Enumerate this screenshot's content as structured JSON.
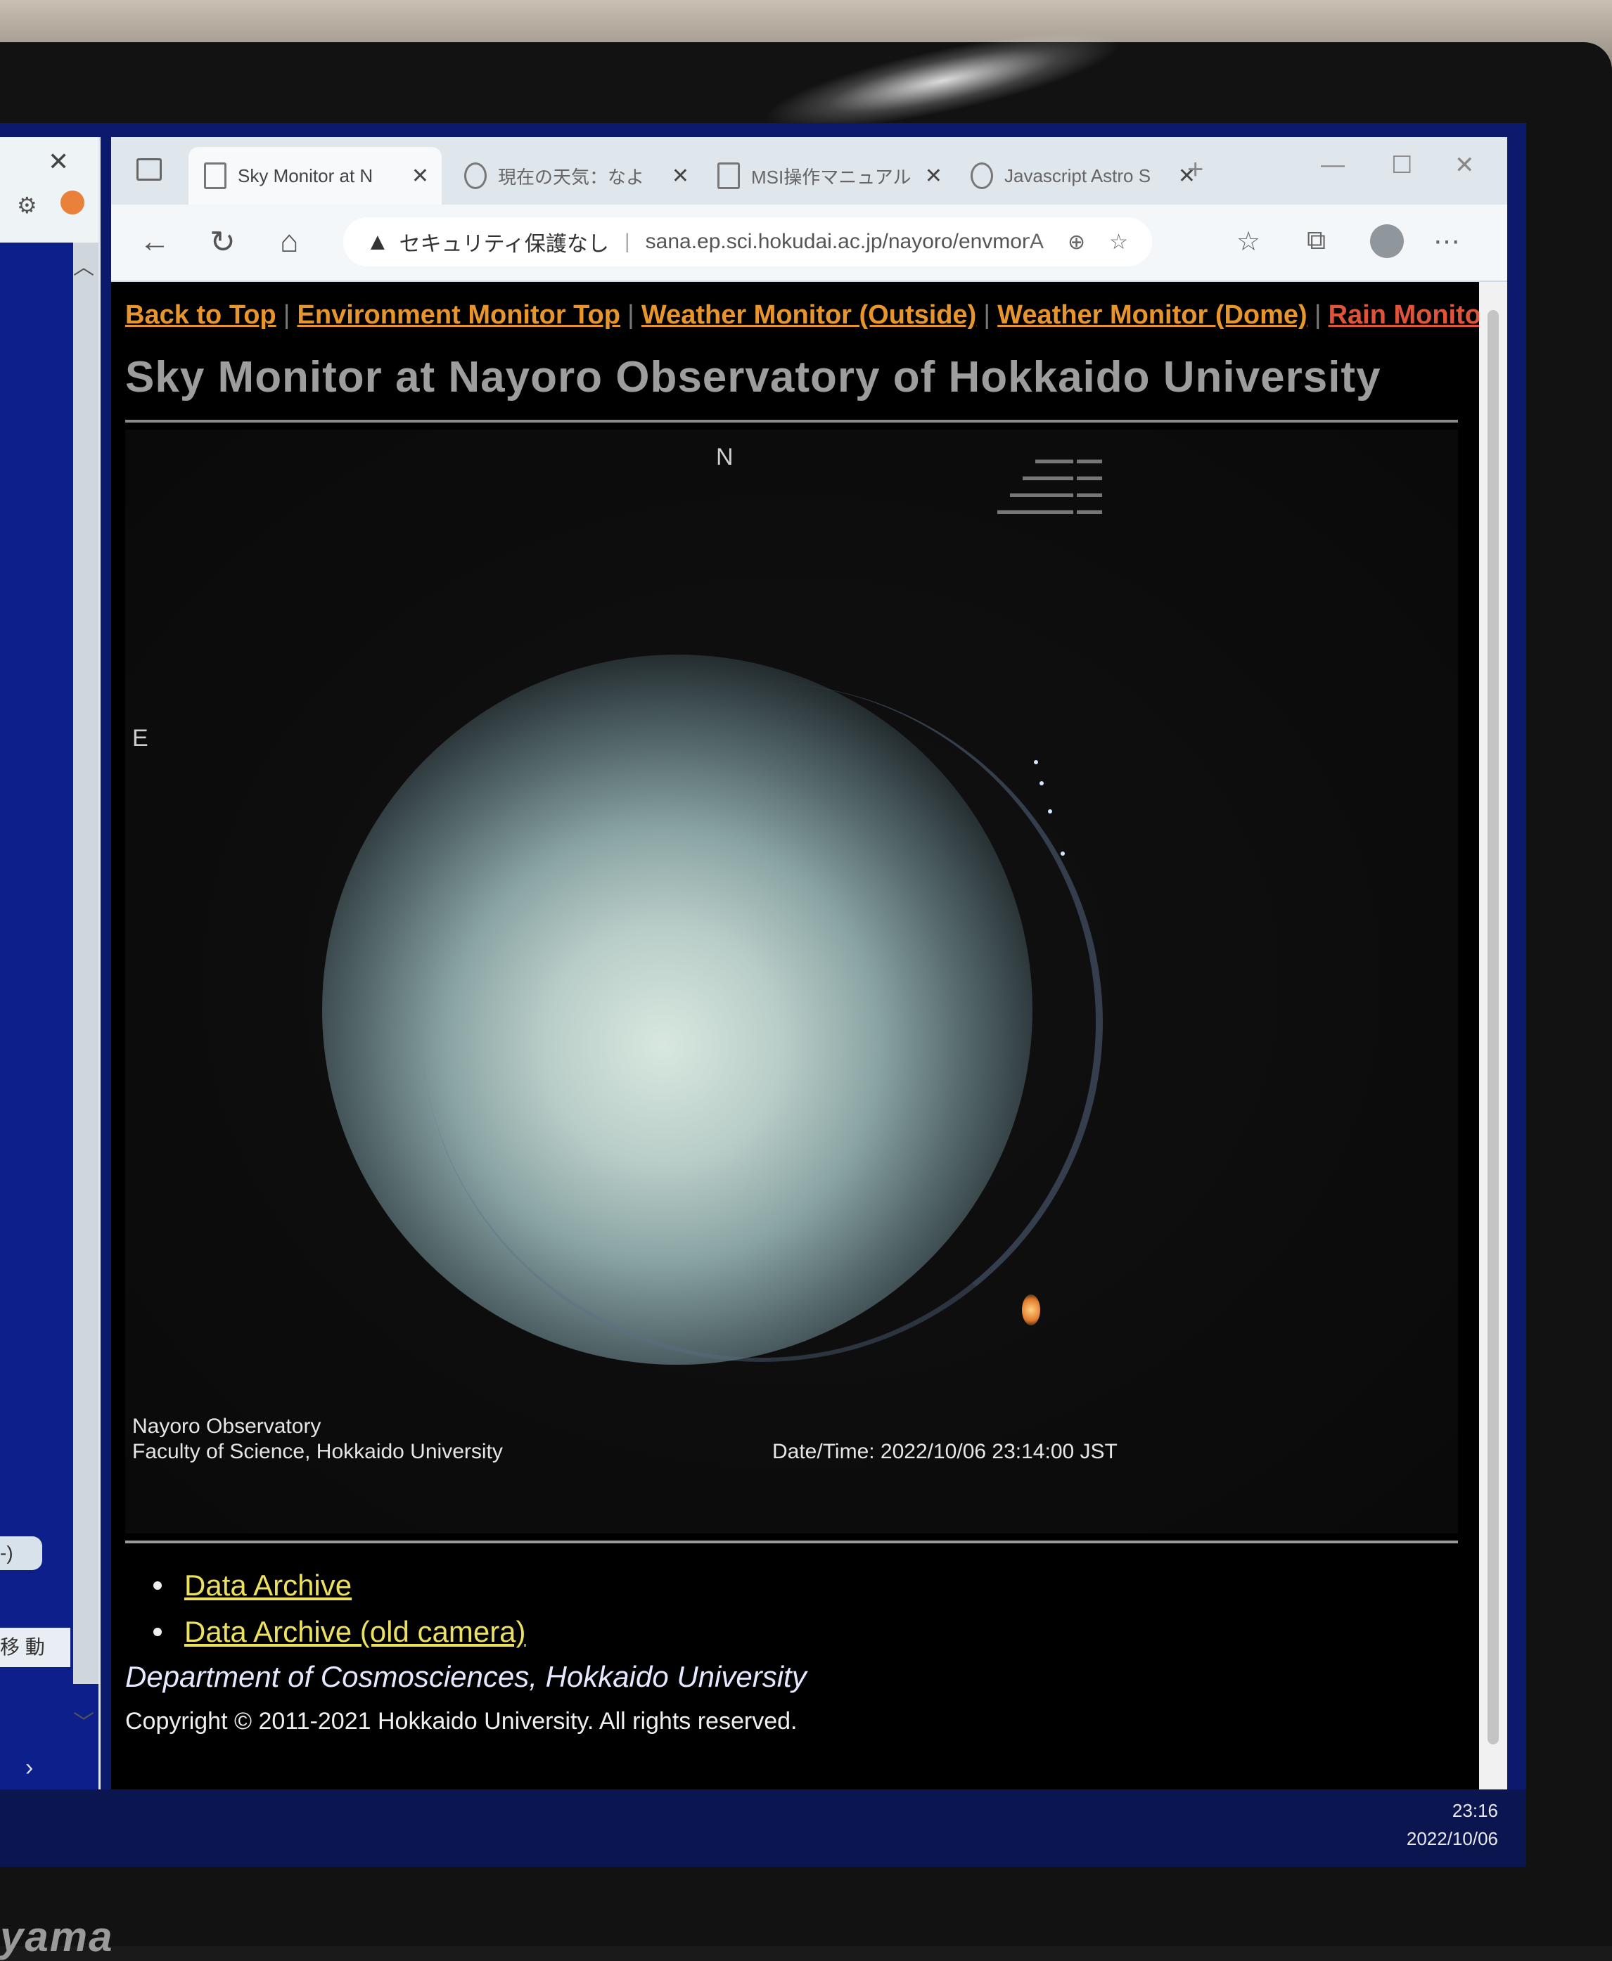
{
  "left_window": {
    "button_label": "-)",
    "band_label": "移 動"
  },
  "browser": {
    "tabs": [
      {
        "title": "Sky Monitor at N",
        "active": true
      },
      {
        "title": "現在の天気：なよ",
        "active": false
      },
      {
        "title": "MSI操作マニュアル",
        "active": false
      },
      {
        "title": "Javascript Astro S",
        "active": false
      }
    ],
    "address": {
      "security_label": "セキュリティ保護なし",
      "url": "sana.ep.sci.hokudai.ac.jp/nayoro/envmon/..."
    }
  },
  "page": {
    "nav_links": [
      {
        "label": "Back to Top"
      },
      {
        "label": "Environment Monitor Top"
      },
      {
        "label": "Weather Monitor (Outside)"
      },
      {
        "label": "Weather Monitor (Dome)"
      },
      {
        "label": "Rain Monitor"
      }
    ],
    "title": "Sky Monitor at Nayoro Observatory of Hokkaido University",
    "sky_image": {
      "north_label": "N",
      "east_label": "E",
      "caption_line1": "Nayoro Observatory",
      "caption_line2": "Faculty of Science, Hokkaido University",
      "datetime": "Date/Time: 2022/10/06 23:14:00 JST"
    },
    "archive_links": [
      {
        "label": "Data Archive"
      },
      {
        "label": "Data Archive (old camera)"
      }
    ],
    "department": "Department of Cosmosciences, Hokkaido University",
    "copyright": "Copyright © 2011-2021 Hokkaido University. All rights reserved."
  },
  "taskbar": {
    "time": "23:16",
    "date": "2022/10/06"
  },
  "monitor": {
    "brand": "yama"
  }
}
